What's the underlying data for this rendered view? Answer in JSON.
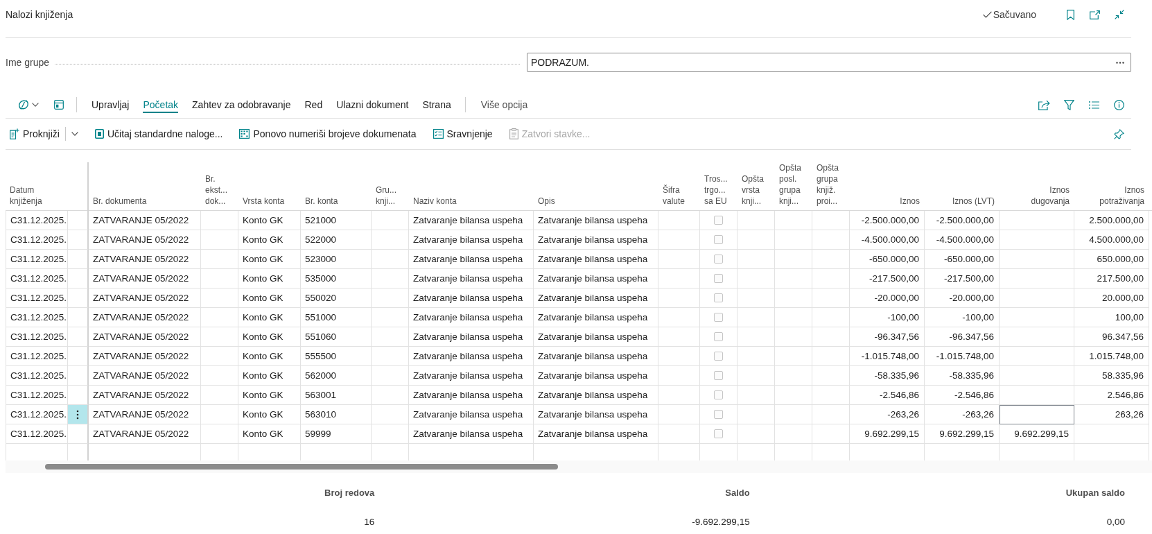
{
  "window": {
    "title": "Nalozi knjiženja",
    "status": "Sačuvano"
  },
  "batch_field": {
    "label": "Ime grupe",
    "value": "PODRAZUM."
  },
  "tabs": [
    {
      "label": "Upravljaj",
      "selected": false
    },
    {
      "label": "Početak",
      "selected": true
    },
    {
      "label": "Zahtev za odobravanje",
      "selected": false
    },
    {
      "label": "Red",
      "selected": false
    },
    {
      "label": "Ulazni dokument",
      "selected": false
    },
    {
      "label": "Strana",
      "selected": false
    }
  ],
  "more_options_button": "Više opcija",
  "actions": [
    {
      "label": "Proknjiži",
      "kind": "split",
      "disabled": false
    },
    {
      "label": "Učitaj standardne naloge...",
      "kind": "plain",
      "disabled": false
    },
    {
      "label": "Ponovo numeriši brojeve dokumenata",
      "kind": "plain",
      "disabled": false
    },
    {
      "label": "Sravnjenje",
      "kind": "plain",
      "disabled": false
    },
    {
      "label": "Zatvori stavke...",
      "kind": "plain",
      "disabled": true
    }
  ],
  "table": {
    "columns": [
      "Datum knjiženja",
      "Br. dokumenta",
      "Br. ekst... dok...",
      "Vrsta konta",
      "Br. konta",
      "Gru... knji...",
      "Naziv konta",
      "Opis",
      "Šifra valute",
      "Tros... trgo... sa EU",
      "Opšta vrsta knji...",
      "Opšta posl. grupa knji...",
      "Opšta grupa knjiž. proi...",
      "Iznos",
      "Iznos (LVT)",
      "Iznos dugovanja",
      "Iznos potraživanja"
    ],
    "rows": [
      {
        "selected": false,
        "debit_amount_focused": false,
        "posting_date": "C31.12.2025.",
        "document_no": "ZATVARANJE 05/2022",
        "account_type": "Konto GK",
        "account_no": "521000",
        "account_name": "Zatvaranje bilansa uspeha",
        "description": "Zatvaranje bilansa uspeha",
        "eu_3_party_trade": false,
        "amount": "-2.500.000,00",
        "amount_lcy": "-2.500.000,00",
        "credit_amount": "2.500.000,00"
      },
      {
        "selected": false,
        "debit_amount_focused": false,
        "posting_date": "C31.12.2025.",
        "document_no": "ZATVARANJE 05/2022",
        "account_type": "Konto GK",
        "account_no": "522000",
        "account_name": "Zatvaranje bilansa uspeha",
        "description": "Zatvaranje bilansa uspeha",
        "eu_3_party_trade": false,
        "amount": "-4.500.000,00",
        "amount_lcy": "-4.500.000,00",
        "credit_amount": "4.500.000,00"
      },
      {
        "selected": false,
        "debit_amount_focused": false,
        "posting_date": "C31.12.2025.",
        "document_no": "ZATVARANJE 05/2022",
        "account_type": "Konto GK",
        "account_no": "523000",
        "account_name": "Zatvaranje bilansa uspeha",
        "description": "Zatvaranje bilansa uspeha",
        "eu_3_party_trade": false,
        "amount": "-650.000,00",
        "amount_lcy": "-650.000,00",
        "credit_amount": "650.000,00"
      },
      {
        "selected": false,
        "debit_amount_focused": false,
        "posting_date": "C31.12.2025.",
        "document_no": "ZATVARANJE 05/2022",
        "account_type": "Konto GK",
        "account_no": "535000",
        "account_name": "Zatvaranje bilansa uspeha",
        "description": "Zatvaranje bilansa uspeha",
        "eu_3_party_trade": false,
        "amount": "-217.500,00",
        "amount_lcy": "-217.500,00",
        "credit_amount": "217.500,00"
      },
      {
        "selected": false,
        "debit_amount_focused": false,
        "posting_date": "C31.12.2025.",
        "document_no": "ZATVARANJE 05/2022",
        "account_type": "Konto GK",
        "account_no": "550020",
        "account_name": "Zatvaranje bilansa uspeha",
        "description": "Zatvaranje bilansa uspeha",
        "eu_3_party_trade": false,
        "amount": "-20.000,00",
        "amount_lcy": "-20.000,00",
        "credit_amount": "20.000,00"
      },
      {
        "selected": false,
        "debit_amount_focused": false,
        "posting_date": "C31.12.2025.",
        "document_no": "ZATVARANJE 05/2022",
        "account_type": "Konto GK",
        "account_no": "551000",
        "account_name": "Zatvaranje bilansa uspeha",
        "description": "Zatvaranje bilansa uspeha",
        "eu_3_party_trade": false,
        "amount": "-100,00",
        "amount_lcy": "-100,00",
        "credit_amount": "100,00"
      },
      {
        "selected": false,
        "debit_amount_focused": false,
        "posting_date": "C31.12.2025.",
        "document_no": "ZATVARANJE 05/2022",
        "account_type": "Konto GK",
        "account_no": "551060",
        "account_name": "Zatvaranje bilansa uspeha",
        "description": "Zatvaranje bilansa uspeha",
        "eu_3_party_trade": false,
        "amount": "-96.347,56",
        "amount_lcy": "-96.347,56",
        "credit_amount": "96.347,56"
      },
      {
        "selected": false,
        "debit_amount_focused": false,
        "posting_date": "C31.12.2025.",
        "document_no": "ZATVARANJE 05/2022",
        "account_type": "Konto GK",
        "account_no": "555500",
        "account_name": "Zatvaranje bilansa uspeha",
        "description": "Zatvaranje bilansa uspeha",
        "eu_3_party_trade": false,
        "amount": "-1.015.748,00",
        "amount_lcy": "-1.015.748,00",
        "credit_amount": "1.015.748,00"
      },
      {
        "selected": false,
        "debit_amount_focused": false,
        "posting_date": "C31.12.2025.",
        "document_no": "ZATVARANJE 05/2022",
        "account_type": "Konto GK",
        "account_no": "562000",
        "account_name": "Zatvaranje bilansa uspeha",
        "description": "Zatvaranje bilansa uspeha",
        "eu_3_party_trade": false,
        "amount": "-58.335,96",
        "amount_lcy": "-58.335,96",
        "credit_amount": "58.335,96"
      },
      {
        "selected": false,
        "debit_amount_focused": false,
        "posting_date": "C31.12.2025.",
        "document_no": "ZATVARANJE 05/2022",
        "account_type": "Konto GK",
        "account_no": "563001",
        "account_name": "Zatvaranje bilansa uspeha",
        "description": "Zatvaranje bilansa uspeha",
        "eu_3_party_trade": false,
        "amount": "-2.546,86",
        "amount_lcy": "-2.546,86",
        "credit_amount": "2.546,86"
      },
      {
        "selected": true,
        "debit_amount_focused": true,
        "posting_date": "C31.12.2025.",
        "document_no": "ZATVARANJE 05/2022",
        "account_type": "Konto GK",
        "account_no": "563010",
        "account_name": "Zatvaranje bilansa uspeha",
        "description": "Zatvaranje bilansa uspeha",
        "eu_3_party_trade": false,
        "amount": "-263,26",
        "amount_lcy": "-263,26",
        "credit_amount": "263,26"
      },
      {
        "selected": false,
        "debit_amount_focused": false,
        "posting_date": "C31.12.2025.",
        "document_no": "ZATVARANJE 05/2022",
        "account_type": "Konto GK",
        "account_no": "59999",
        "account_name": "Zatvaranje bilansa uspeha",
        "description": "Zatvaranje bilansa uspeha",
        "eu_3_party_trade": false,
        "amount": "9.692.299,15",
        "amount_lcy": "9.692.299,15",
        "debit_amount": "9.692.299,15"
      }
    ]
  },
  "totals": [
    {
      "label": "Broj redova",
      "value": "16"
    },
    {
      "label": "Saldo",
      "value": "-9.692.299,15"
    },
    {
      "label": "Ukupan saldo",
      "value": "0,00"
    }
  ]
}
